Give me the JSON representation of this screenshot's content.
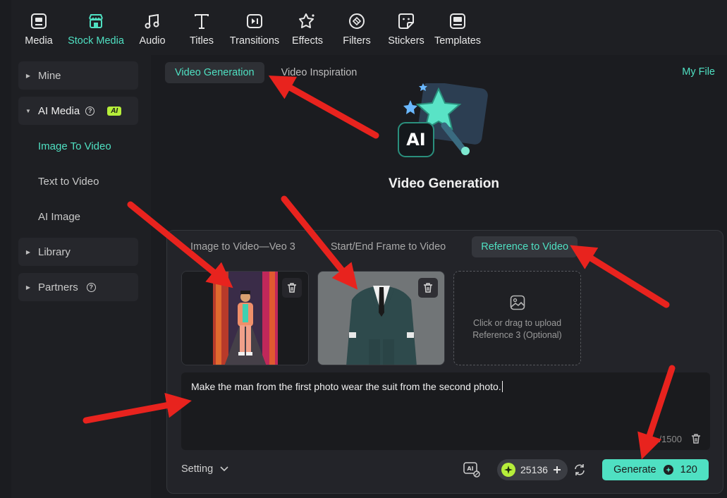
{
  "toolbar": {
    "items": [
      {
        "label": "Media",
        "icon": "media-icon"
      },
      {
        "label": "Stock Media",
        "icon": "stock-media-icon",
        "active": true
      },
      {
        "label": "Audio",
        "icon": "music-note-icon"
      },
      {
        "label": "Titles",
        "icon": "titles-icon"
      },
      {
        "label": "Transitions",
        "icon": "transitions-icon"
      },
      {
        "label": "Effects",
        "icon": "effects-icon"
      },
      {
        "label": "Filters",
        "icon": "filters-icon"
      },
      {
        "label": "Stickers",
        "icon": "stickers-icon"
      },
      {
        "label": "Templates",
        "icon": "templates-icon"
      }
    ]
  },
  "sidebar": {
    "items": [
      {
        "label": "Mine"
      },
      {
        "label": "AI Media",
        "badge": "AI"
      },
      {
        "label": "Image To Video"
      },
      {
        "label": "Text to Video"
      },
      {
        "label": "AI Image"
      },
      {
        "label": "Library"
      },
      {
        "label": "Partners"
      }
    ]
  },
  "main": {
    "tabs": [
      {
        "label": "Video Generation"
      },
      {
        "label": "Video Inspiration"
      }
    ],
    "my_file": "My File",
    "hero": {
      "title": "Video Generation",
      "art_text": "AI"
    },
    "panel": {
      "modes": [
        {
          "label": "Image to Video—Veo 3"
        },
        {
          "label": "Start/End Frame to Video"
        },
        {
          "label": "Reference to Video"
        }
      ],
      "upload": {
        "line1": "Click or drag to upload",
        "line2": "Reference 3 (Optional)"
      },
      "prompt": "Make the man from the first photo wear the suit from the second photo.",
      "char_count": "/1500",
      "setting_label": "Setting",
      "credits": "25136",
      "generate_label": "Generate",
      "generate_cost": "120"
    }
  },
  "colors": {
    "accent": "#4fe0c2",
    "badge": "#b6ee3a",
    "annotation_arrow": "#e8231e"
  }
}
